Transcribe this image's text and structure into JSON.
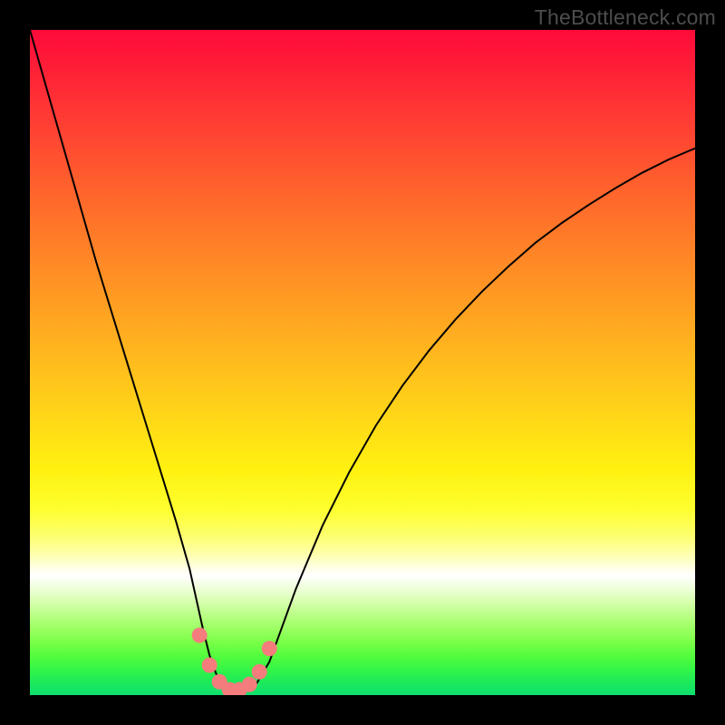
{
  "watermark": "TheBottleneck.com",
  "colors": {
    "frame": "#000000",
    "curve": "#000000",
    "marker_fill": "#f47c7c",
    "marker_stroke": "#f47c7c",
    "watermark": "#4d4d4d"
  },
  "chart_data": {
    "type": "line",
    "title": "",
    "xlabel": "",
    "ylabel": "",
    "xlim": [
      0,
      100
    ],
    "ylim": [
      0,
      100
    ],
    "grid": false,
    "series": [
      {
        "name": "bottleneck-curve",
        "x": [
          0,
          2,
          4,
          6,
          8,
          10,
          12,
          14,
          16,
          18,
          20,
          22,
          24,
          25,
          26,
          27,
          28,
          29,
          30,
          31,
          32,
          33,
          34,
          36,
          38,
          40,
          44,
          48,
          52,
          56,
          60,
          64,
          68,
          72,
          76,
          80,
          84,
          88,
          92,
          96,
          100
        ],
        "y": [
          100,
          93,
          86,
          79,
          72,
          65,
          58.5,
          52,
          45.5,
          39,
          32.5,
          26,
          19,
          14.5,
          10,
          6,
          3.2,
          1.6,
          0.8,
          0.5,
          0.5,
          0.8,
          1.6,
          5,
          10.5,
          16,
          25.5,
          33.5,
          40.5,
          46.5,
          51.8,
          56.5,
          60.7,
          64.5,
          68,
          71,
          73.7,
          76.2,
          78.5,
          80.5,
          82.2
        ]
      }
    ],
    "markers": {
      "name": "highlighted-points",
      "x": [
        25.5,
        27.0,
        28.5,
        30.0,
        31.5,
        33.0,
        34.5,
        36.0
      ],
      "y": [
        9.0,
        4.5,
        2.0,
        0.8,
        0.8,
        1.6,
        3.5,
        7.0
      ]
    }
  }
}
